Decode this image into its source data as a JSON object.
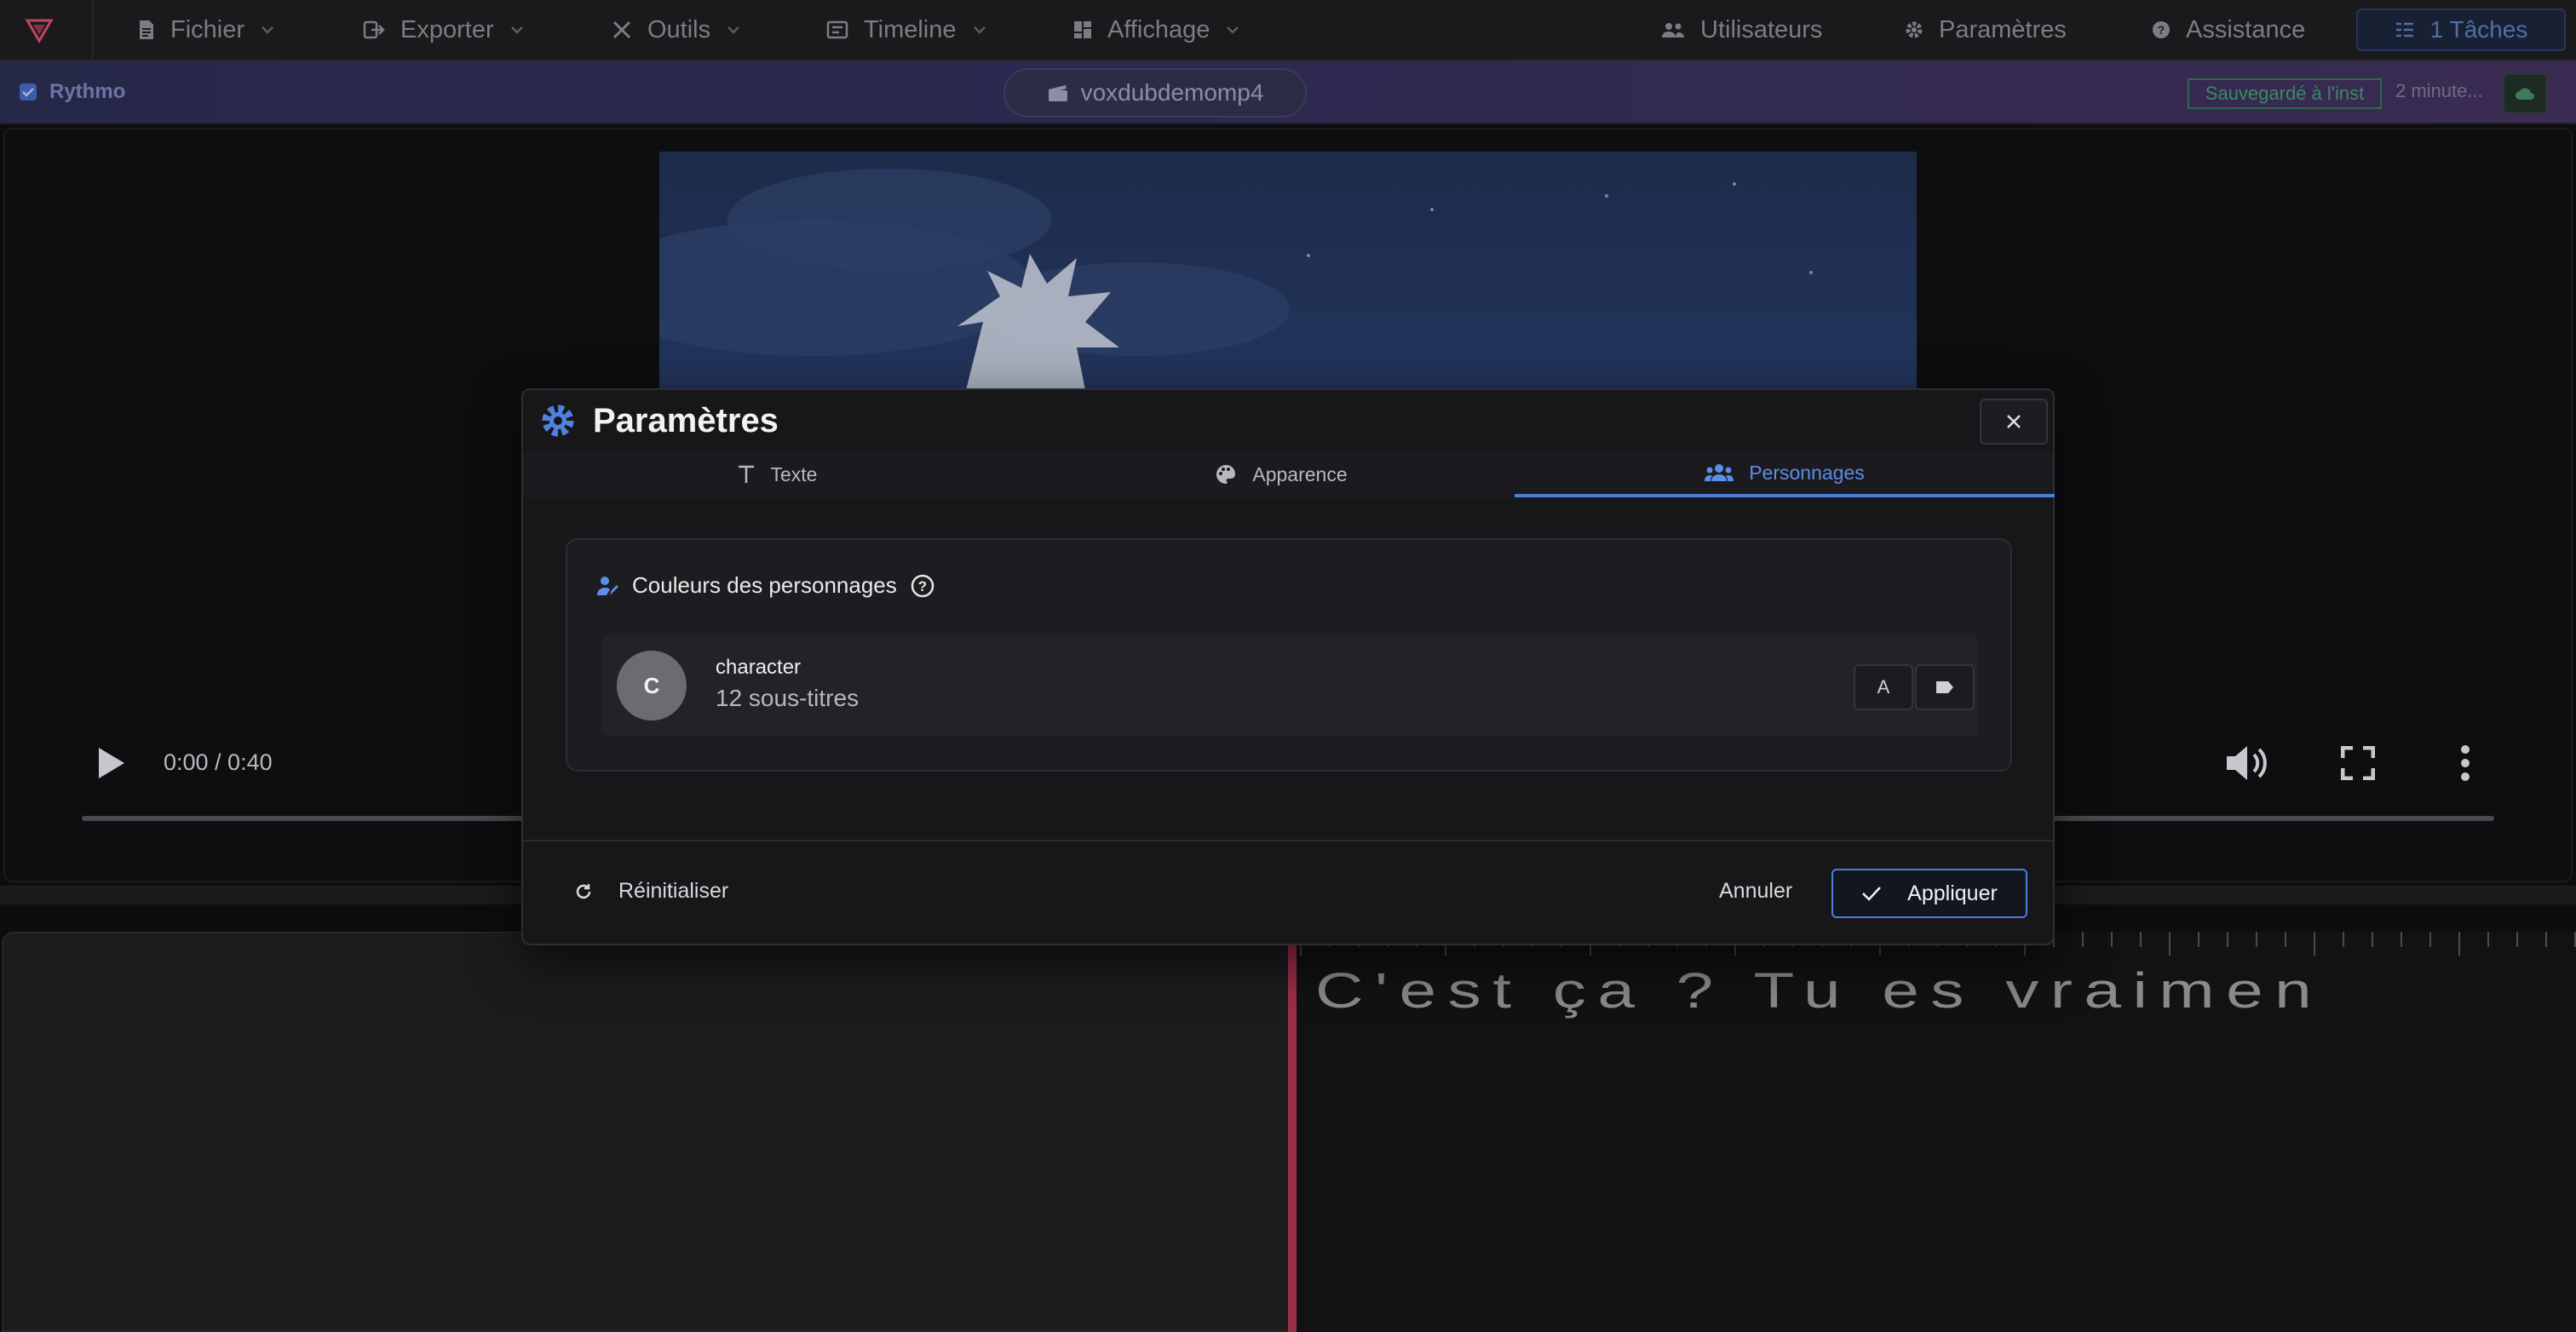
{
  "menubar": {
    "items": [
      {
        "label": "Fichier",
        "icon": "file-icon"
      },
      {
        "label": "Exporter",
        "icon": "export-icon"
      },
      {
        "label": "Outils",
        "icon": "tools-icon"
      },
      {
        "label": "Timeline",
        "icon": "timeline-icon"
      },
      {
        "label": "Affichage",
        "icon": "dashboard-icon"
      }
    ],
    "right": {
      "users": "Utilisateurs",
      "settings": "Paramètres",
      "help": "Assistance",
      "tasks": "1 Tâches"
    }
  },
  "project": {
    "app_label": "Rythmo",
    "file_name": "voxdubdemomp4",
    "saved": "Sauvegardé à l'inst",
    "time_ago": "2 minute..."
  },
  "video": {
    "time": "0:00 / 0:40",
    "progress": 0
  },
  "timeline": {
    "rythmo_text": "C'est ça ? Tu es vraimen"
  },
  "modal": {
    "title": "Paramètres",
    "tabs": [
      {
        "label": "Texte",
        "icon": "text-icon",
        "active": false
      },
      {
        "label": "Apparence",
        "icon": "palette-icon",
        "active": false
      },
      {
        "label": "Personnages",
        "icon": "people-icon",
        "active": true
      }
    ],
    "section_title": "Couleurs des personnages",
    "characters": [
      {
        "initial": "C",
        "name": "character",
        "count": "12 sous-titres",
        "text_button": "A"
      }
    ],
    "reset_label": "Réinitialiser",
    "cancel_label": "Annuler",
    "apply_label": "Appliquer"
  },
  "colors": {
    "accent": "#4a7ddc",
    "saved": "#2d6a4a",
    "playhead": "#9b2f4a"
  }
}
